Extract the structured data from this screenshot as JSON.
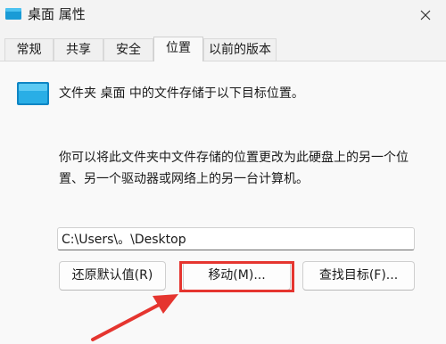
{
  "window": {
    "title": "桌面 属性"
  },
  "tabs": [
    {
      "label": "常规"
    },
    {
      "label": "共享"
    },
    {
      "label": "安全"
    },
    {
      "label": "位置"
    },
    {
      "label": "以前的版本"
    }
  ],
  "active_tab": "位置",
  "location": {
    "description": "文件夹 桌面 中的文件存储于以下目标位置。",
    "info_line1": "你可以将此文件夹中文件存储的位置更改为此硬盘上的另一个位",
    "info_line2": "置、另一个驱动器或网络上的另一台计算机。",
    "path_value": "C:\\Users\\。\\Desktop"
  },
  "buttons": {
    "restore_default": "还原默认值(R)",
    "move": "移动(M)...",
    "find_target": "查找目标(F)..."
  },
  "annotation": {
    "highlight_color": "#e5352f"
  }
}
